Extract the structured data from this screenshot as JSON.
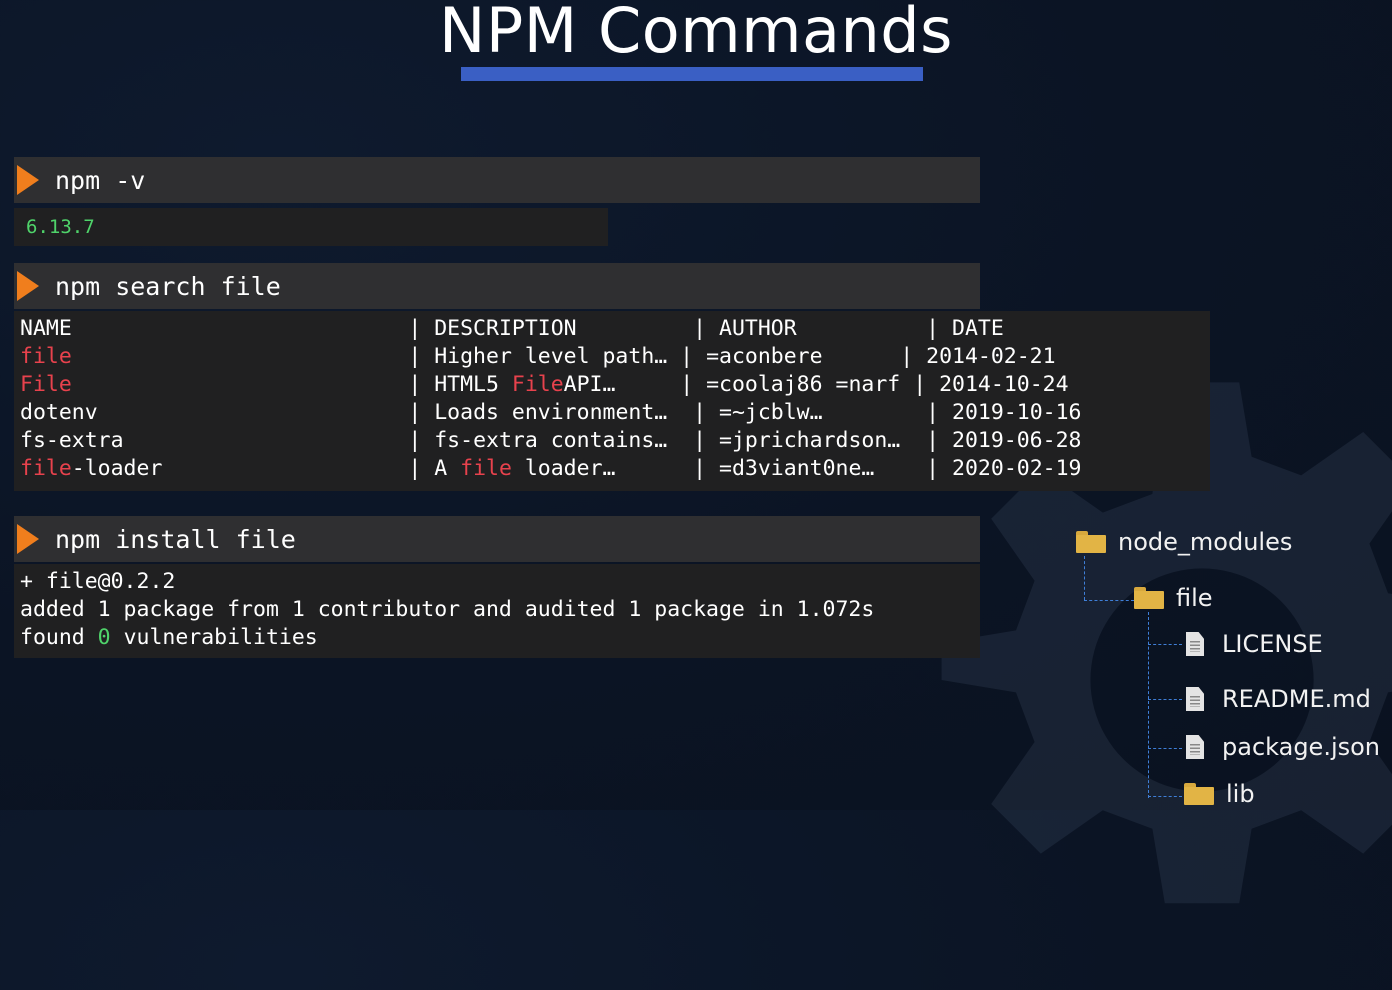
{
  "slide": {
    "title": "NPM Commands"
  },
  "commands": [
    {
      "text": "npm -v"
    },
    {
      "text": "npm search file"
    },
    {
      "text": "npm install file"
    }
  ],
  "version_output": "6.13.7",
  "search_table": {
    "headers": [
      "NAME",
      "DESCRIPTION",
      "AUTHOR",
      "DATE"
    ],
    "rows": [
      {
        "name": "file",
        "description": "Higher level path…",
        "author": "=aconbere",
        "date": "2014-02-21"
      },
      {
        "name": "File",
        "description": "HTML5 FileAPI…",
        "author": "=coolaj86 =narf",
        "date": "2014-10-24"
      },
      {
        "name": "dotenv",
        "description": "Loads environment…",
        "author": "=~jcblw…",
        "date": "2019-10-16"
      },
      {
        "name": "fs-extra",
        "description": "fs-extra contains…",
        "author": "=jprichardson…",
        "date": "2019-06-28"
      },
      {
        "name": "file-loader",
        "description": "A file loader…",
        "author": "=d3viant0ne…",
        "date": "2020-02-19"
      }
    ]
  },
  "install_output": {
    "line1": "+ file@0.2.2",
    "line2": "added 1 package from 1 contributor and audited 1 package in 1.072s",
    "line3_prefix": "found ",
    "line3_count": "0",
    "line3_suffix": " vulnerabilities"
  },
  "file_tree": {
    "root": "node_modules",
    "folder": "file",
    "files": [
      "LICENSE",
      "README.md",
      "package.json"
    ],
    "subfolder": "lib"
  },
  "colors": {
    "accent_orange": "#f07e1d",
    "title_underline": "#3a5fc4",
    "match_red": "#e8424d",
    "success_green": "#4fd36a"
  },
  "icons": [
    "play-arrow-icon",
    "folder-icon",
    "document-icon",
    "gear-icon"
  ]
}
